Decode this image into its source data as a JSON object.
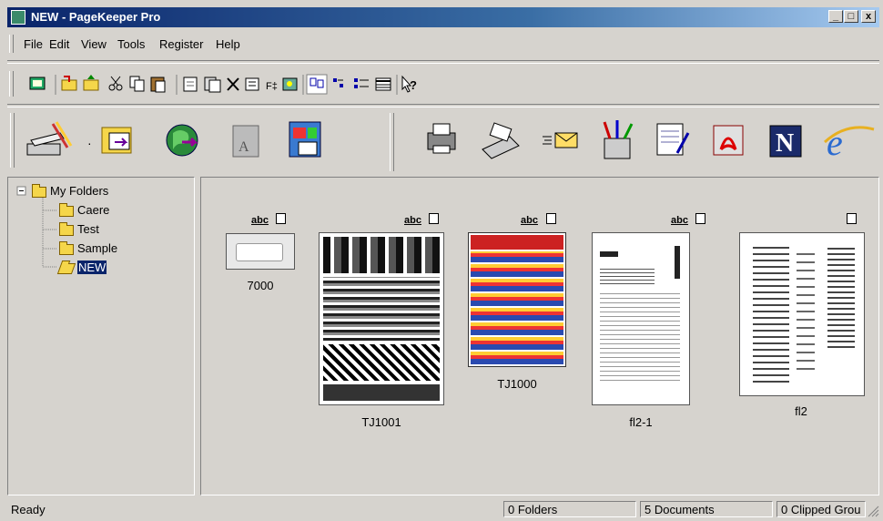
{
  "window": {
    "title": "NEW - PageKeeper Pro",
    "min": "_",
    "max": "□",
    "close": "x"
  },
  "menu": [
    "File",
    "Edit",
    "View",
    "Tools",
    "Register",
    "Help"
  ],
  "tree": {
    "root": "My Folders",
    "children": [
      "Caere",
      "Test",
      "Sample",
      "NEW"
    ]
  },
  "documents": [
    {
      "name": "7000",
      "badge": "abc"
    },
    {
      "name": "TJ1001",
      "badge": "abc"
    },
    {
      "name": "TJ1000",
      "badge": "abc"
    },
    {
      "name": "fl2-1",
      "badge": "abc"
    },
    {
      "name": "fl2",
      "badge": ""
    }
  ],
  "status": {
    "ready": "Ready",
    "folders": "0 Folders",
    "documents": "5 Documents",
    "clipped": "0 Clipped Grou"
  }
}
